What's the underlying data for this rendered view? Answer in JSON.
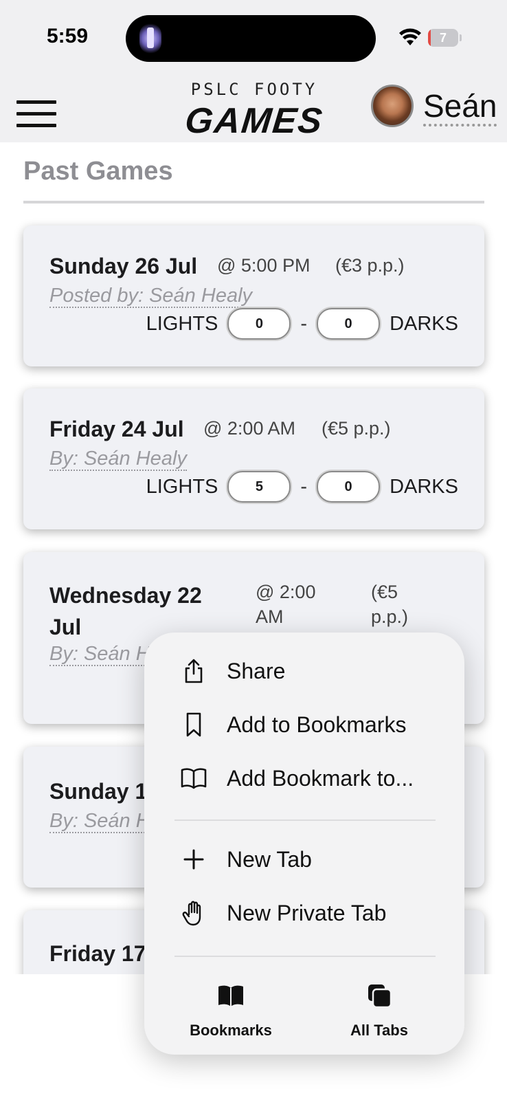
{
  "status_bar": {
    "time": "5:59",
    "battery": "7",
    "battery_level": 0.07
  },
  "header": {
    "brand_top": "PSLC FOOTY",
    "brand_main": "GAMES",
    "user_name": "Seán"
  },
  "section": {
    "title": "Past Games"
  },
  "games": [
    {
      "date": "Sunday 26 Jul",
      "time": "@ 5:00 PM",
      "price": "(€3 p.p.)",
      "posted_by": "Posted by: Seán Healy",
      "lights_label": "LIGHTS",
      "lights_score": "0",
      "dash": "-",
      "darks_score": "0",
      "darks_label": "DARKS"
    },
    {
      "date": "Friday 24 Jul",
      "time": "@ 2:00 AM",
      "price": "(€5 p.p.)",
      "posted_by": "By: Seán Healy",
      "lights_label": "LIGHTS",
      "lights_score": "5",
      "dash": "-",
      "darks_score": "0",
      "darks_label": "DARKS"
    },
    {
      "date_line1": "Wednesday 22",
      "date_line2": "Jul",
      "time_line1": "@ 2:00",
      "time_line2": "AM",
      "price_line1": "(€5",
      "price_line2": "p.p.)",
      "posted_by": "By: Seán H"
    },
    {
      "date": "Sunday 1",
      "posted_by": "By: Seán H"
    },
    {
      "date": "Friday 17"
    }
  ],
  "menu": {
    "items": [
      {
        "label": "Share",
        "icon": "share-icon"
      },
      {
        "label": "Add to Bookmarks",
        "icon": "bookmark-icon"
      },
      {
        "label": "Add Bookmark to...",
        "icon": "book-open-icon"
      },
      {
        "label": "New Tab",
        "icon": "plus-icon"
      },
      {
        "label": "New Private Tab",
        "icon": "hand-icon"
      }
    ],
    "bottom": [
      {
        "label": "Bookmarks",
        "icon": "bookmarks-book-icon"
      },
      {
        "label": "All Tabs",
        "icon": "tabs-icon"
      }
    ]
  }
}
